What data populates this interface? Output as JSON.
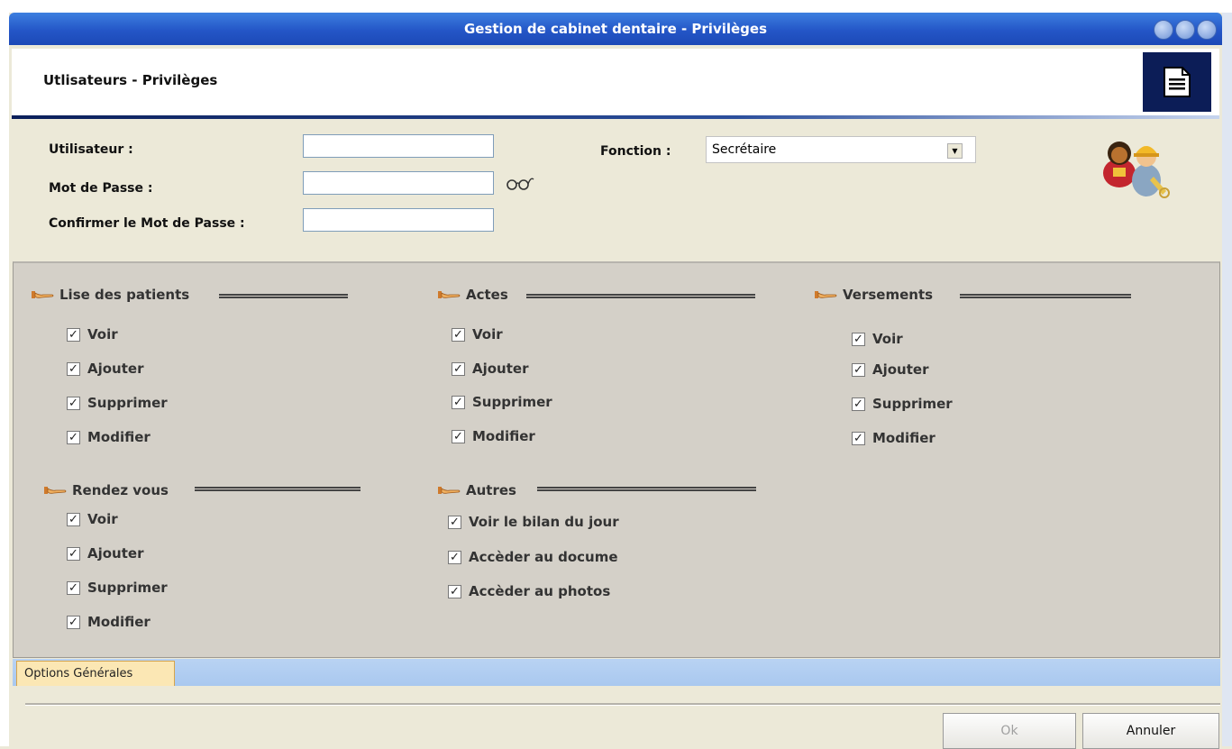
{
  "window": {
    "title": "Gestion de cabinet dentaire - Privilèges"
  },
  "header": {
    "title": "Utlisateurs - Privilèges",
    "icon": "document-icon"
  },
  "form": {
    "user_label": "Utilisateur :",
    "user_value": "",
    "password_label": "Mot de Passe :",
    "password_value": "",
    "show_password_icon": "glasses-icon",
    "confirm_label": "Confirmer le Mot de Passe :",
    "confirm_value": "",
    "function_label": "Fonction :",
    "function_value": "Secrétaire",
    "users_icon": "users-icon"
  },
  "groups": {
    "patients": {
      "title": "Lise des patients",
      "items": [
        {
          "label": "Voir",
          "checked": true
        },
        {
          "label": "Ajouter",
          "checked": true
        },
        {
          "label": "Supprimer",
          "checked": true
        },
        {
          "label": "Modifier",
          "checked": true
        }
      ]
    },
    "actes": {
      "title": "Actes",
      "items": [
        {
          "label": "Voir",
          "checked": true
        },
        {
          "label": "Ajouter",
          "checked": true
        },
        {
          "label": "Supprimer",
          "checked": true
        },
        {
          "label": "Modifier",
          "checked": true
        }
      ]
    },
    "versements": {
      "title": "Versements",
      "items": [
        {
          "label": "Voir",
          "checked": true
        },
        {
          "label": "Ajouter",
          "checked": true
        },
        {
          "label": "Supprimer",
          "checked": true
        },
        {
          "label": "Modifier",
          "checked": true
        }
      ]
    },
    "rdv": {
      "title": "Rendez vous",
      "items": [
        {
          "label": "Voir",
          "checked": true
        },
        {
          "label": "Ajouter",
          "checked": true
        },
        {
          "label": "Supprimer",
          "checked": true
        },
        {
          "label": "Modifier",
          "checked": true
        }
      ]
    },
    "autres": {
      "title": "Autres",
      "items": [
        {
          "label": "Voir le bilan du jour",
          "checked": true
        },
        {
          "label": "Accèder au docume",
          "checked": true
        },
        {
          "label": "Accèder au photos",
          "checked": true
        }
      ]
    }
  },
  "tabs": [
    {
      "label": "Options Générales",
      "active": true
    }
  ],
  "buttons": {
    "ok": "Ok",
    "cancel": "Annuler"
  },
  "colors": {
    "title_bar": "#2456c7",
    "header_accent": "#0c1d57",
    "tab_active": "#fbe7b4",
    "tab_strip": "#b9d3f3"
  }
}
